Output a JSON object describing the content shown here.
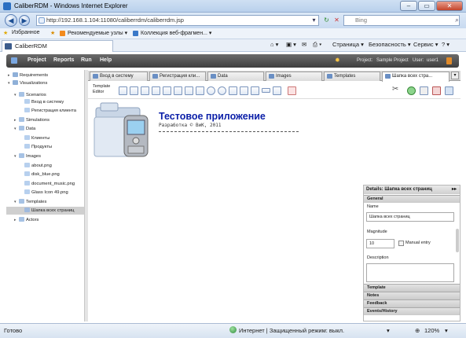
{
  "window": {
    "title": "CaliberRDM - Windows Internet Explorer",
    "minimize": "–",
    "maximize": "▭",
    "close": "✕"
  },
  "address": {
    "url": "http://192.168.1.104:11080/caliberrdm/caliberrdm.jsp",
    "search_placeholder": "Bing"
  },
  "favorites": {
    "label": "Избранное",
    "suggested": "Рекомендуемые узлы ▾",
    "collection": "Коллекция веб-фрагмен... ▾"
  },
  "tab": {
    "label": "CaliberRDM"
  },
  "commandbar": {
    "page": "Страница ▾",
    "safety": "Безопасность ▾",
    "service": "Сервис ▾",
    "help": "? ▾"
  },
  "app": {
    "menu": [
      "Project",
      "Reports",
      "Run",
      "Help"
    ],
    "project_label": "Project:",
    "project_value": "Sample Project",
    "user_label": "User:",
    "user_value": "user1"
  },
  "tree": [
    {
      "label": "Requirements",
      "toggle": "▸"
    },
    {
      "label": "Visualizations",
      "toggle": "▾"
    },
    {
      "label": "Scenarios",
      "toggle": "▾"
    },
    {
      "label": "Вход в систему",
      "toggle": ""
    },
    {
      "label": "Регистрация клиента",
      "toggle": ""
    },
    {
      "label": "Simulations",
      "toggle": "▸"
    },
    {
      "label": "Data",
      "toggle": "▾"
    },
    {
      "label": "Клиенты",
      "toggle": ""
    },
    {
      "label": "Продукты",
      "toggle": ""
    },
    {
      "label": "Images",
      "toggle": "▾"
    },
    {
      "label": "about.png",
      "toggle": ""
    },
    {
      "label": "disk_blue.png",
      "toggle": ""
    },
    {
      "label": "document_music.png",
      "toggle": ""
    },
    {
      "label": "Glass Icon 49.png",
      "toggle": ""
    },
    {
      "label": "Templates",
      "toggle": "▾"
    },
    {
      "label": "Шапка всех страниц",
      "toggle": ""
    },
    {
      "label": "Actors",
      "toggle": "▸"
    }
  ],
  "editor_tabs": [
    "Вход в систему",
    "Регистрация кли...",
    "Data",
    "Images",
    "Templates",
    "Шапка всех стра..."
  ],
  "editor_toolbar": {
    "label_line1": "Template",
    "label_line2": "Editor"
  },
  "canvas": {
    "title": "Тестовое приложение",
    "subtitle": "Разработка © ВиК, 2011",
    "divider": "-----------------------------------------------"
  },
  "details": {
    "header": "Details: Шапка всех страниц",
    "general": "General",
    "name_label": "Name",
    "name_value": "Шапка всех страниц",
    "magnitude_label": "Magnitude",
    "magnitude_value": "10",
    "manual_entry": "Manual entry",
    "description_label": "Description",
    "sections": [
      "Template",
      "Notes",
      "Feedback",
      "Events/History"
    ]
  },
  "status": {
    "text": "Готово",
    "zone": "Интернет | Защищенный режим: выкл.",
    "zoom": "120%"
  },
  "colors": {
    "title_blue": "#0b1fa8",
    "app_header": "#4a4a4a",
    "selection": "#cfcfcf"
  }
}
